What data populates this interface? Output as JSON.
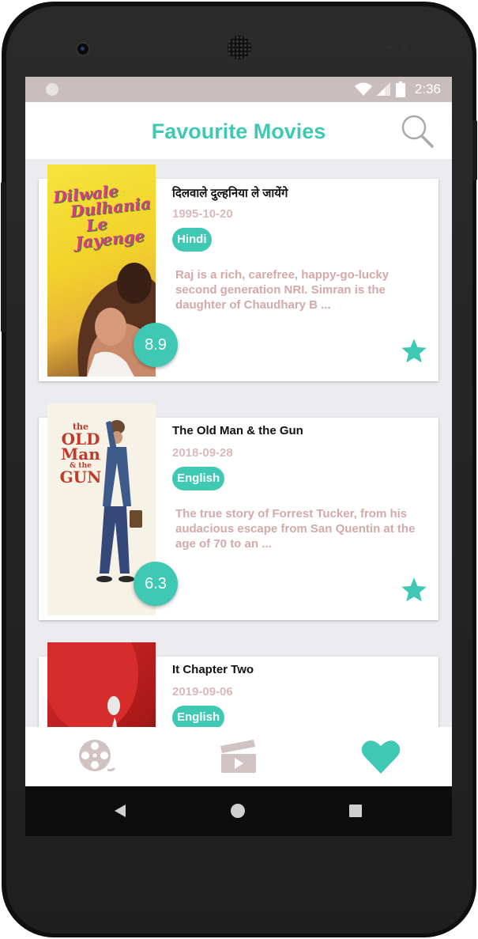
{
  "status_bar": {
    "time": "2:36"
  },
  "app_bar": {
    "title": "Favourite Movies",
    "search_icon": "search-icon"
  },
  "movies": [
    {
      "title": "दिलवाले दुल्हनिया ले जायेंगे",
      "release_date": "1995-10-20",
      "language": "Hindi",
      "overview": "Raj is a rich, carefree, happy-go-lucky second generation NRI. Simran is the daughter of Chaudhary B ...",
      "rating": "8.9",
      "poster_text": [
        "Dilwale",
        "Dulhania",
        "Le",
        "Jayenge"
      ]
    },
    {
      "title": "The Old Man & the Gun",
      "release_date": "2018-09-28",
      "language": "English",
      "overview": "The true story of Forrest Tucker, from his audacious escape from San Quentin at the age of 70 to an  ...",
      "rating": "6.3",
      "poster_text": [
        "the",
        "OLD",
        "Man",
        "& the",
        "GUN"
      ]
    },
    {
      "title": "It Chapter Two",
      "release_date": "2019-09-06",
      "language": "English"
    }
  ],
  "bottom_nav": [
    {
      "icon": "film-reel-icon",
      "active": false
    },
    {
      "icon": "clapperboard-icon",
      "active": false
    },
    {
      "icon": "heart-icon",
      "active": true
    }
  ],
  "colors": {
    "accent": "#3fc9b4",
    "date": "#d9b9b9",
    "overview": "#d4a9a9",
    "inactive_icon": "#d2c3c3",
    "status_bar": "#c9bdbd"
  }
}
